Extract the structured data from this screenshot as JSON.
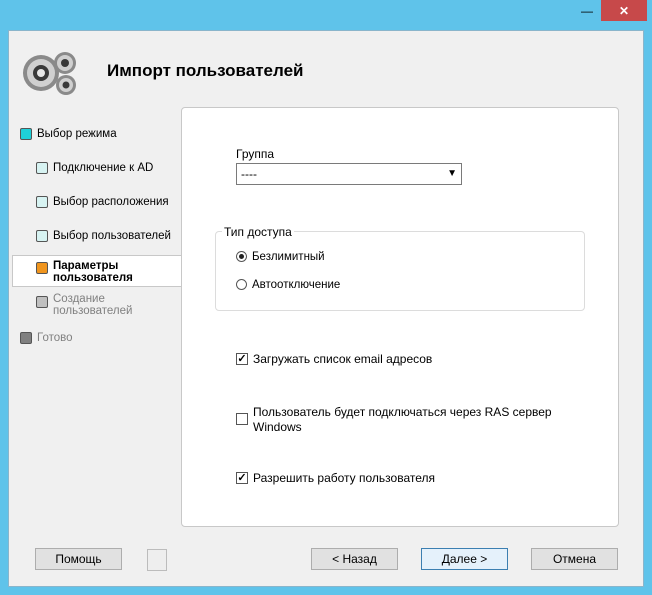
{
  "window": {
    "minimize_glyph": "—",
    "close_glyph": "✕"
  },
  "header": {
    "title": "Импорт пользователей",
    "logo_icon": "gears-icon"
  },
  "nav": {
    "items": [
      {
        "label": "Выбор режима",
        "color": "#1ed0d8",
        "state": "done"
      },
      {
        "label": "Подключение к AD",
        "color": "#d7f3f2",
        "state": "done"
      },
      {
        "label": "Выбор расположения",
        "color": "#d7f3f2",
        "state": "done"
      },
      {
        "label": "Выбор пользователей",
        "color": "#d7f3f2",
        "state": "done"
      },
      {
        "label": "Параметры пользователя",
        "color": "#f0951e",
        "state": "active"
      },
      {
        "label": "Создание пользователей",
        "color": "#c0c0c0",
        "state": "pending"
      },
      {
        "label": "Готово",
        "color": "#808080",
        "state": "pending"
      }
    ]
  },
  "form": {
    "group_label": "Группа",
    "group_value": "----",
    "access_type_label": "Тип доступа",
    "radio_unlimited": "Безлимитный",
    "radio_autooff": "Автоотключение",
    "selected_access": "Безлимитный",
    "chk_email": {
      "label": "Загружать список email адресов",
      "checked": true
    },
    "chk_ras": {
      "label": "Пользователь будет подключаться через RAS сервер Windows",
      "checked": false
    },
    "chk_enable": {
      "label": "Разрешить работу пользователя",
      "checked": true
    }
  },
  "buttons": {
    "help": "Помощь",
    "back": "< Назад",
    "next": "Далее >",
    "cancel": "Отмена"
  }
}
